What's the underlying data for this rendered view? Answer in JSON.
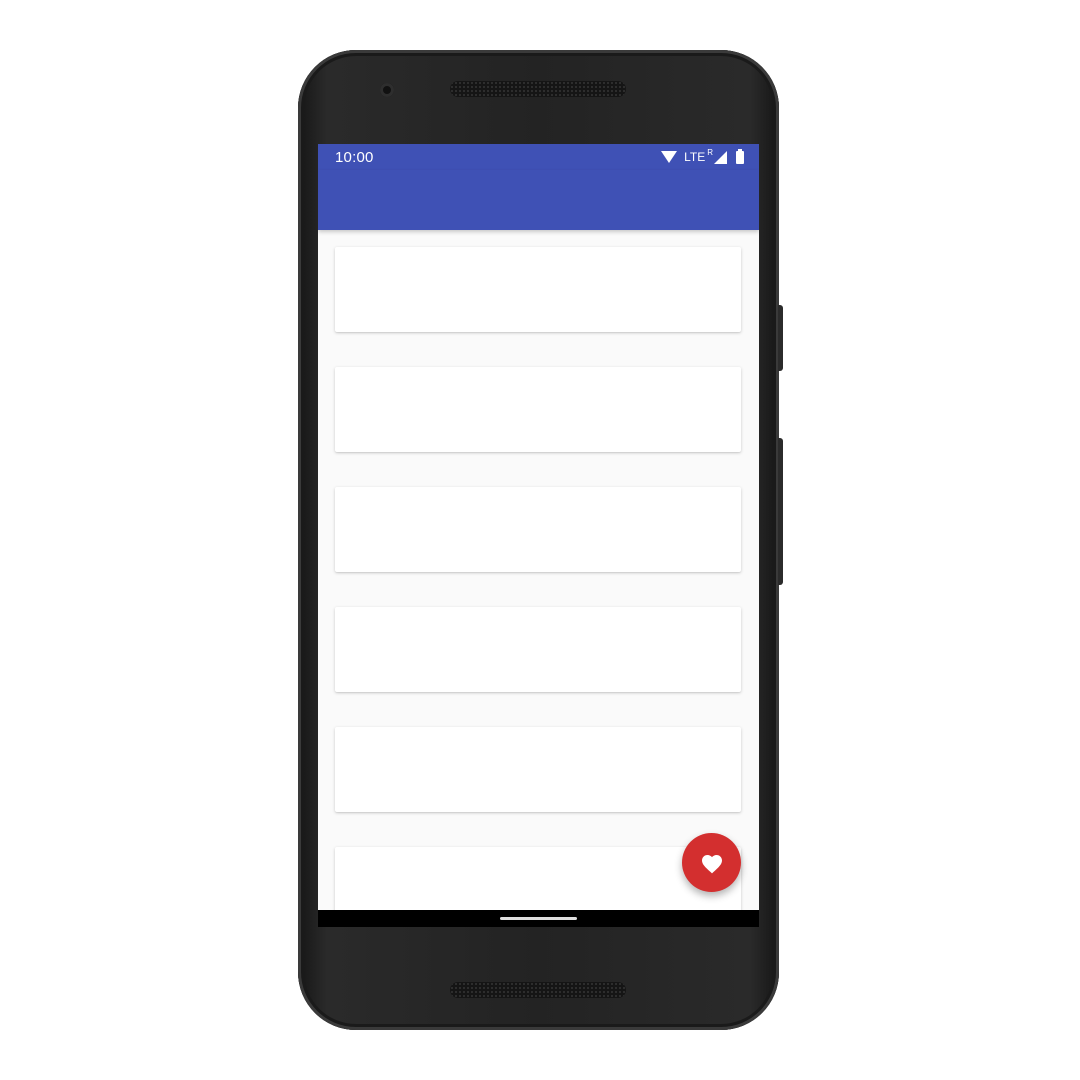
{
  "device": {
    "frame_color": "#232323",
    "side_buttons": [
      "power",
      "volume"
    ]
  },
  "status_bar": {
    "time": "10:00",
    "network_label": "LTE",
    "roaming_label": "R",
    "icons": [
      "wifi-icon",
      "signal-icon",
      "battery-icon"
    ],
    "background": "#3f51b5"
  },
  "app_bar": {
    "title": "",
    "background": "#3f51b5"
  },
  "list": {
    "items": [
      {
        "text": ""
      },
      {
        "text": ""
      },
      {
        "text": ""
      },
      {
        "text": ""
      },
      {
        "text": ""
      },
      {
        "text": ""
      }
    ]
  },
  "fab": {
    "icon": "heart-icon",
    "color": "#d32f2f"
  },
  "nav_bar": {
    "type": "gesture-handle"
  }
}
